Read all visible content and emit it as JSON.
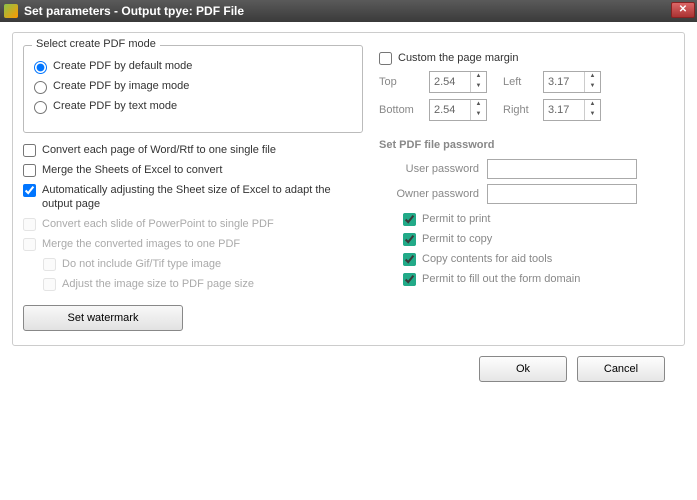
{
  "window": {
    "title": "Set parameters - Output tpye: PDF File"
  },
  "mode_group": {
    "legend": "Select create PDF mode",
    "options": {
      "default": "Create PDF by default mode",
      "image": "Create PDF by image mode",
      "text": "Create PDF by text mode"
    },
    "selected": "default"
  },
  "checks": {
    "convert_word_single": "Convert each page of Word/Rtf to one single file",
    "merge_excel": "Merge the Sheets of Excel to convert",
    "auto_adjust_excel": "Automatically adjusting the Sheet size of Excel to adapt the output page",
    "convert_ppt": "Convert each slide of PowerPoint to single PDF",
    "merge_images": "Merge the converted images to one PDF",
    "exclude_gif": "Do not include Gif/Tif type image",
    "adjust_image_size": "Adjust the image size to PDF page size"
  },
  "watermark_btn": "Set watermark",
  "margin": {
    "custom_label": "Custom the page margin",
    "top_label": "Top",
    "bottom_label": "Bottom",
    "left_label": "Left",
    "right_label": "Right",
    "top": "2.54",
    "bottom": "2.54",
    "left": "3.17",
    "right": "3.17"
  },
  "password": {
    "section": "Set PDF file password",
    "user_label": "User password",
    "owner_label": "Owner password",
    "user": "",
    "owner": "",
    "permits": {
      "print": "Permit to print",
      "copy": "Permit to copy",
      "aid": "Copy contents for aid tools",
      "form": "Permit to fill out the form domain"
    }
  },
  "buttons": {
    "ok": "Ok",
    "cancel": "Cancel"
  }
}
